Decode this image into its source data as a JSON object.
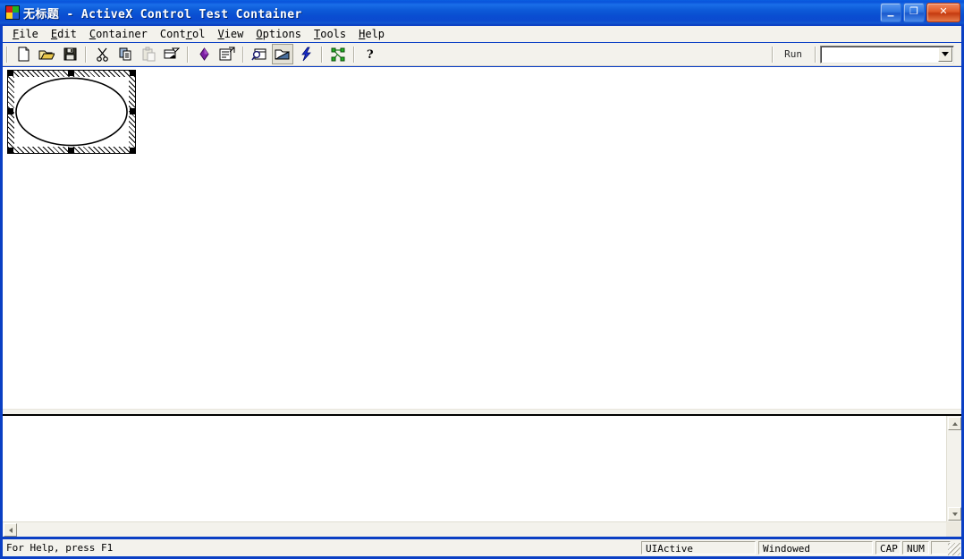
{
  "window": {
    "title": "无标题 - ActiveX Control Test Container",
    "app_icon": "activex-app-icon",
    "controls": {
      "minimize_label": "_",
      "maximize_label": "❐",
      "close_label": "✕"
    }
  },
  "menubar": {
    "items": [
      {
        "name": "file",
        "pre": "F",
        "mnemonic": "i",
        "post": "le",
        "full": "File"
      },
      {
        "name": "edit",
        "pre": "",
        "mnemonic": "E",
        "post": "dit",
        "full": "Edit"
      },
      {
        "name": "container",
        "pre": "",
        "mnemonic": "C",
        "post": "ontainer",
        "full": "Container"
      },
      {
        "name": "control",
        "pre": "Cont",
        "mnemonic": "r",
        "post": "ol",
        "full": "Control"
      },
      {
        "name": "view",
        "pre": "",
        "mnemonic": "V",
        "post": "iew",
        "full": "View"
      },
      {
        "name": "options",
        "pre": "",
        "mnemonic": "O",
        "post": "ptions",
        "full": "Options"
      },
      {
        "name": "tools",
        "pre": "",
        "mnemonic": "T",
        "post": "ools",
        "full": "Tools"
      },
      {
        "name": "help",
        "pre": "",
        "mnemonic": "H",
        "post": "elp",
        "full": "Help"
      }
    ]
  },
  "toolbar": {
    "buttons": [
      {
        "name": "new-icon",
        "enabled": true,
        "pressed": false
      },
      {
        "name": "open-folder-icon",
        "enabled": true,
        "pressed": false
      },
      {
        "name": "save-floppy-icon",
        "enabled": true,
        "pressed": false
      },
      {
        "name": "cut-scissors-icon",
        "enabled": true,
        "pressed": false
      },
      {
        "name": "copy-pages-icon",
        "enabled": true,
        "pressed": false
      },
      {
        "name": "paste-clipboard-icon",
        "enabled": false,
        "pressed": false
      },
      {
        "name": "insert-control-icon",
        "enabled": true,
        "pressed": false
      },
      {
        "name": "properties-diamond-icon",
        "enabled": true,
        "pressed": false
      },
      {
        "name": "property-pages-icon",
        "enabled": true,
        "pressed": false
      },
      {
        "name": "view-control-icon",
        "enabled": true,
        "pressed": false
      },
      {
        "name": "open-container-icon",
        "enabled": true,
        "pressed": true
      },
      {
        "name": "invoke-methods-icon",
        "enabled": true,
        "pressed": false
      },
      {
        "name": "logging-graph-icon",
        "enabled": true,
        "pressed": false
      },
      {
        "name": "help-question-icon",
        "enabled": true,
        "pressed": false
      }
    ],
    "run_label": "Run",
    "run_combo": {
      "value": "",
      "placeholder": ""
    }
  },
  "client_area": {
    "control": {
      "name": "activex-ellipse-control",
      "selected": true,
      "shape": "ellipse",
      "handles": 8
    }
  },
  "log_pane": {
    "text": ""
  },
  "statusbar": {
    "help_text": "For Help, press F1",
    "panes": [
      {
        "name": "ui-active",
        "text": "UIActive"
      },
      {
        "name": "windowed",
        "text": "Windowed"
      },
      {
        "name": "caps-lock",
        "text": "CAP"
      },
      {
        "name": "num-lock",
        "text": "NUM"
      },
      {
        "name": "scroll-lock",
        "text": ""
      }
    ]
  },
  "colors": {
    "titlebar_blue": "#0a4fd2",
    "window_border": "#0a3fc4",
    "face": "#f3f2ec",
    "close_red": "#c43a10",
    "accent_purple": "#7b1fa2",
    "accent_green": "#22b422",
    "accent_yellow": "#e8c64a"
  }
}
